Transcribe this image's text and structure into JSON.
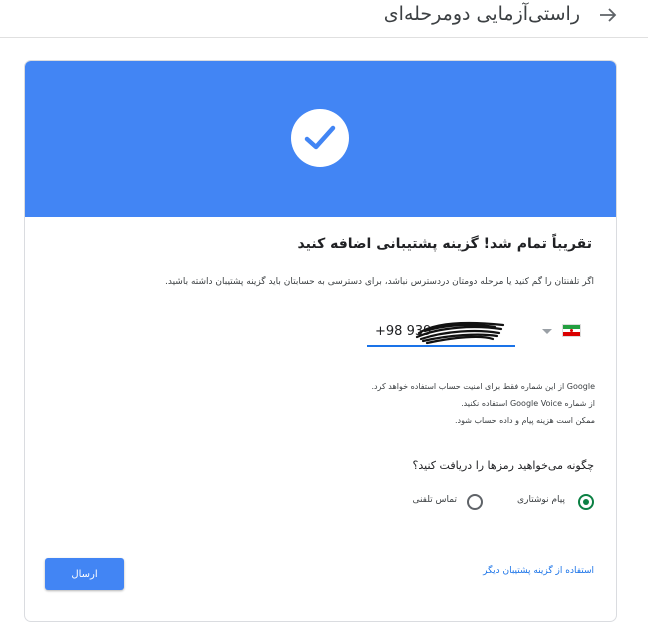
{
  "header": {
    "title": "راستی‌آزمایی دومرحله‌ای",
    "back_icon": "arrow-right-icon"
  },
  "hero": {
    "color": "#4285f4",
    "icon": "checkmark-circle-icon"
  },
  "content": {
    "heading": "تقریباً تمام شد! گزینه پشتیبانی اضافه کنید",
    "description": "اگر تلفنتان را گم کنید یا مرحله دومتان دردسترس نباشد، برای دسترسی به حسابتان باید گزینه پشتیبان داشته باشید."
  },
  "phone": {
    "country_flag_icon": "iran-flag-icon",
    "value": "+98 939"
  },
  "note": {
    "line1": "Google از این شماره فقط برای امنیت حساب استفاده خواهد کرد.",
    "line2": "از شماره Google Voice استفاده نکنید.",
    "line3": "ممکن است هزینه پیام و داده حساب شود."
  },
  "delivery": {
    "question": "چگونه می‌خواهید رمزها را دریافت کنید؟",
    "options": [
      {
        "label": "پیام نوشتاری",
        "selected": true
      },
      {
        "label": "تماس تلفنی",
        "selected": false
      }
    ]
  },
  "actions": {
    "send_label": "ارسال",
    "alternate_link": "استفاده از گزینه پشتیبان دیگر"
  }
}
